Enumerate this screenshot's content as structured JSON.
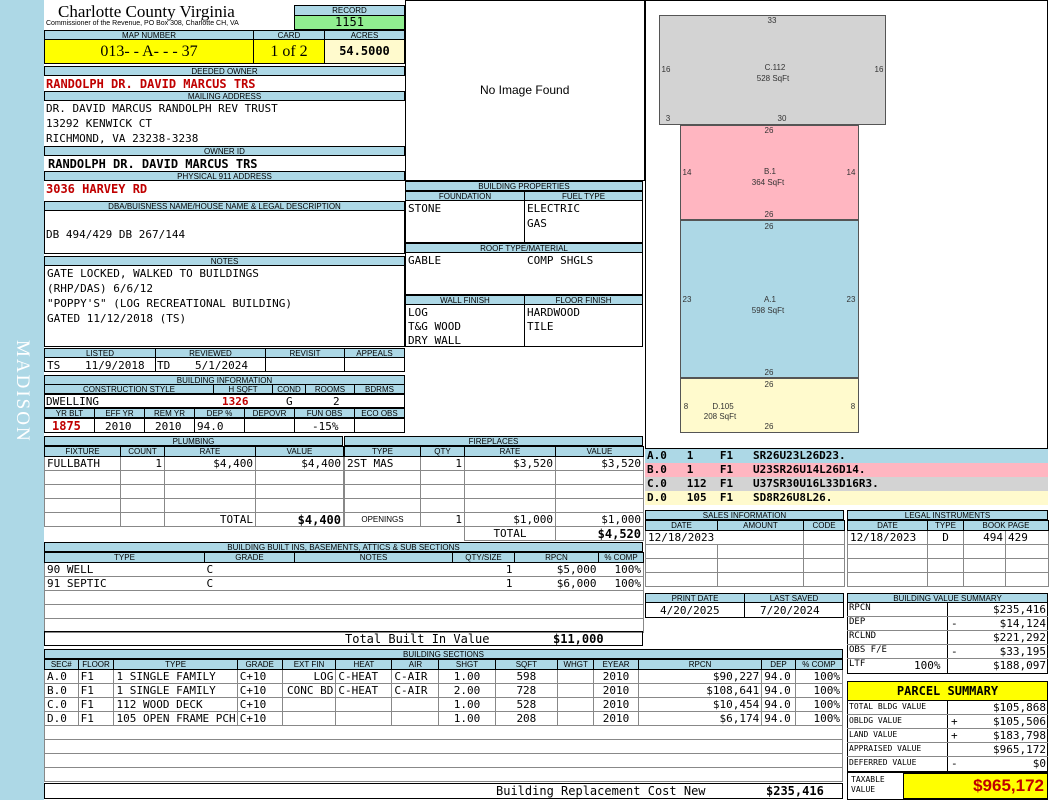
{
  "sidebar_text": "MADISON",
  "county": {
    "title": "Charlotte County Virginia",
    "subtitle": "Commissioner of the Revenue, PO Box 308, Charlotte CH, VA"
  },
  "record": {
    "label": "RECORD",
    "value": "1151"
  },
  "map_number": {
    "label": "MAP NUMBER",
    "value": "013- - A- - - 37"
  },
  "card": {
    "label": "CARD",
    "value": "1 of 2"
  },
  "acres": {
    "label": "ACRES",
    "value": "54.5000"
  },
  "deeded_owner": {
    "label": "DEEDED OWNER",
    "value": "RANDOLPH DR. DAVID MARCUS TRS"
  },
  "mailing_address": {
    "label": "MAILING ADDRESS",
    "lines": [
      "DR. DAVID MARCUS RANDOLPH REV TRUST",
      "13292 KENWICK CT",
      "RICHMOND, VA 23238-3238"
    ]
  },
  "owner_id": {
    "label": "OWNER ID",
    "value": "RANDOLPH DR. DAVID MARCUS TRS"
  },
  "physical_address": {
    "label": "PHYSICAL 911 ADDRESS",
    "value": "3036 HARVEY RD"
  },
  "legal_desc": {
    "label": "DBA/BUISNESS NAME/HOUSE NAME & LEGAL DESCRIPTION",
    "value": "DB 494/429 DB 267/144"
  },
  "notes": {
    "label": "NOTES",
    "lines": [
      "GATE LOCKED, WALKED TO BUILDINGS",
      "(RHP/DAS) 6/6/12",
      "\"POPPY'S\" (LOG RECREATIONAL BUILDING)",
      "GATED 11/12/2018 (TS)"
    ]
  },
  "listing": {
    "labels": [
      "LISTED",
      "REVIEWED",
      "REVISIT",
      "APPEALS"
    ],
    "listed_by": "TS",
    "listed_date": "11/9/2018",
    "reviewed_by": "TD",
    "reviewed_date": "5/1/2024"
  },
  "building_info": {
    "label": "BUILDING INFORMATION",
    "headers": [
      "CONSTRUCTION STYLE",
      "H SQFT",
      "COND",
      "ROOMS",
      "BDRMS"
    ],
    "style": "DWELLING",
    "hsqft": "1326",
    "cond": "G",
    "rooms": "2",
    "bdrms": "",
    "headers2": [
      "YR BLT",
      "EFF YR",
      "REM YR",
      "DEP %",
      "DEPOVR",
      "FUN OBS",
      "ECO OBS"
    ],
    "yr_blt": "1875",
    "eff_yr": "2010",
    "rem_yr": "2010",
    "dep": "94.0",
    "depovr": "",
    "fun_obs": "-15%",
    "eco_obs": ""
  },
  "no_image": "No Image Found",
  "building_properties": {
    "label": "BUILDING PROPERTIES",
    "foundation_label": "FOUNDATION",
    "foundation": "STONE",
    "fuel_label": "FUEL TYPE",
    "fuel": [
      "ELECTRIC",
      "GAS"
    ],
    "roof_label": "ROOF TYPE/MATERIAL",
    "roof_type": "GABLE",
    "roof_material": "COMP SHGLS",
    "wall_label": "WALL FINISH",
    "wall": [
      "LOG",
      "T&G WOOD",
      "DRY WALL"
    ],
    "floor_label": "FLOOR FINISH",
    "floor": [
      "HARDWOOD",
      "TILE"
    ]
  },
  "sketch": {
    "c": {
      "name": "C.112",
      "area": "528 SqFt",
      "top": "33",
      "left": "16",
      "right": "16",
      "bl": "3",
      "bottom": "30"
    },
    "b": {
      "name": "B.1",
      "area": "364 SqFt",
      "top": "26",
      "left": "14",
      "right": "14",
      "bottom": "26"
    },
    "a": {
      "name": "A.1",
      "area": "598 SqFt",
      "top": "26",
      "left": "23",
      "right": "23",
      "bottom": "26"
    },
    "d": {
      "name": "D.105",
      "area": "208 SqFt",
      "top": "26",
      "left": "8",
      "right": "8",
      "bottom": "26"
    }
  },
  "sketch_codes": [
    {
      "text": "A.0   1    F1   SR26U23L26D23.",
      "color": "#add8e6"
    },
    {
      "text": "B.0   1    F1   U23SR26U14L26D14.",
      "color": "#ffb6c1"
    },
    {
      "text": "C.0   112  F1   U37SR30U16L33D16R3.",
      "color": "#d3d3d3"
    },
    {
      "text": "D.0   105  F1   SD8R26U8L26.",
      "color": "#fffacd"
    }
  ],
  "plumbing": {
    "label": "PLUMBING",
    "headers": [
      "FIXTURE",
      "COUNT",
      "RATE",
      "VALUE"
    ],
    "rows": [
      {
        "fixture": "FULLBATH",
        "count": "1",
        "rate": "$4,400",
        "value": "$4,400"
      }
    ],
    "total_label": "TOTAL",
    "total": "$4,400"
  },
  "fireplaces": {
    "label": "FIREPLACES",
    "headers": [
      "TYPE",
      "QTY",
      "RATE",
      "VALUE"
    ],
    "rows": [
      {
        "type": "2ST MAS",
        "qty": "1",
        "rate": "$3,520",
        "value": "$3,520"
      }
    ],
    "openings_label": "OPENINGS",
    "openings_qty": "1",
    "openings_rate": "$1,000",
    "openings_value": "$1,000",
    "total_label": "TOTAL",
    "total": "$4,520"
  },
  "sales": {
    "label": "SALES INFORMATION",
    "headers": [
      "DATE",
      "AMOUNT",
      "CODE"
    ],
    "rows": [
      {
        "date": "12/18/2023",
        "amount": "",
        "code": ""
      }
    ]
  },
  "legal": {
    "label": "LEGAL INSTRUMENTS",
    "headers": [
      "DATE",
      "TYPE",
      "BOOK PAGE"
    ],
    "rows": [
      {
        "date": "12/18/2023",
        "type": "D",
        "book": "494",
        "page": "429"
      }
    ]
  },
  "builtins": {
    "label": "BUILDING BUILT INS, BASEMENTS, ATTICS & SUB SECTIONS",
    "headers": [
      "TYPE",
      "GRADE",
      "NOTES",
      "QTY/SIZE",
      "RPCN",
      "% COMP"
    ],
    "rows": [
      {
        "type": "90 WELL",
        "grade": "C",
        "notes": "",
        "qty": "1",
        "rpcn": "$5,000",
        "comp": "100%"
      },
      {
        "type": "91 SEPTIC",
        "grade": "C",
        "notes": "",
        "qty": "1",
        "rpcn": "$6,000",
        "comp": "100%"
      }
    ],
    "total_label": "Total Built In Value",
    "total": "$11,000"
  },
  "print_info": {
    "print_label": "PRINT DATE",
    "print_date": "4/20/2025",
    "saved_label": "LAST SAVED",
    "saved_date": "7/20/2024"
  },
  "value_summary": {
    "label": "BUILDING VALUE SUMMARY",
    "rows": [
      {
        "label": "RPCN",
        "sign": "",
        "value": "$235,416"
      },
      {
        "label": "DEP",
        "sign": "-",
        "value": "$14,124"
      },
      {
        "label": "RCLND",
        "sign": "",
        "value": "$221,292"
      },
      {
        "label": "OBS F/E",
        "sign": "-",
        "value": "$33,195"
      },
      {
        "label": "LTF",
        "pct": "100%",
        "sign": "",
        "value": "$188,097"
      }
    ]
  },
  "sections": {
    "label": "BUILDING SECTIONS",
    "headers": [
      "SEC#",
      "FLOOR",
      "TYPE",
      "GRADE",
      "EXT FIN",
      "HEAT",
      "AIR",
      "SHGT",
      "SQFT",
      "WHGT",
      "EYEAR",
      "RPCN",
      "DEP",
      "% COMP"
    ],
    "rows": [
      {
        "sec": "A.0",
        "floor": "F1",
        "type": "1 SINGLE FAMILY",
        "grade": "C+10",
        "ext": "LOG",
        "heat": "C-HEAT",
        "air": "C-AIR",
        "shgt": "1.00",
        "sqft": "598",
        "whgt": "",
        "eyear": "2010",
        "rpcn": "$90,227",
        "dep": "94.0",
        "comp": "100%"
      },
      {
        "sec": "B.0",
        "floor": "F1",
        "type": "1 SINGLE FAMILY",
        "grade": "C+10",
        "ext": "CONC BD",
        "heat": "C-HEAT",
        "air": "C-AIR",
        "shgt": "2.00",
        "sqft": "728",
        "whgt": "",
        "eyear": "2010",
        "rpcn": "$108,641",
        "dep": "94.0",
        "comp": "100%"
      },
      {
        "sec": "C.0",
        "floor": "F1",
        "type": "112 WOOD DECK",
        "grade": "C+10",
        "ext": "",
        "heat": "",
        "air": "",
        "shgt": "1.00",
        "sqft": "528",
        "whgt": "",
        "eyear": "2010",
        "rpcn": "$10,454",
        "dep": "94.0",
        "comp": "100%"
      },
      {
        "sec": "D.0",
        "floor": "F1",
        "type": "105 OPEN FRAME PCH",
        "grade": "C+10",
        "ext": "",
        "heat": "",
        "air": "",
        "shgt": "1.00",
        "sqft": "208",
        "whgt": "",
        "eyear": "2010",
        "rpcn": "$6,174",
        "dep": "94.0",
        "comp": "100%"
      }
    ],
    "total_label": "Building Replacement Cost New",
    "total": "$235,416"
  },
  "parcel_summary": {
    "label": "PARCEL SUMMARY",
    "rows": [
      {
        "label": "TOTAL BLDG VALUE",
        "sign": "",
        "value": "$105,868"
      },
      {
        "label": "OBLDG VALUE",
        "sign": "+",
        "value": "$105,506"
      },
      {
        "label": "LAND VALUE",
        "sign": "+",
        "value": "$183,798"
      },
      {
        "label": "APPRAISED VALUE",
        "sign": "",
        "value": "$965,172"
      },
      {
        "label": "DEFERRED VALUE",
        "sign": "-",
        "value": "$0"
      }
    ],
    "taxable_label": "TAXABLE VALUE",
    "taxable": "$965,172"
  }
}
